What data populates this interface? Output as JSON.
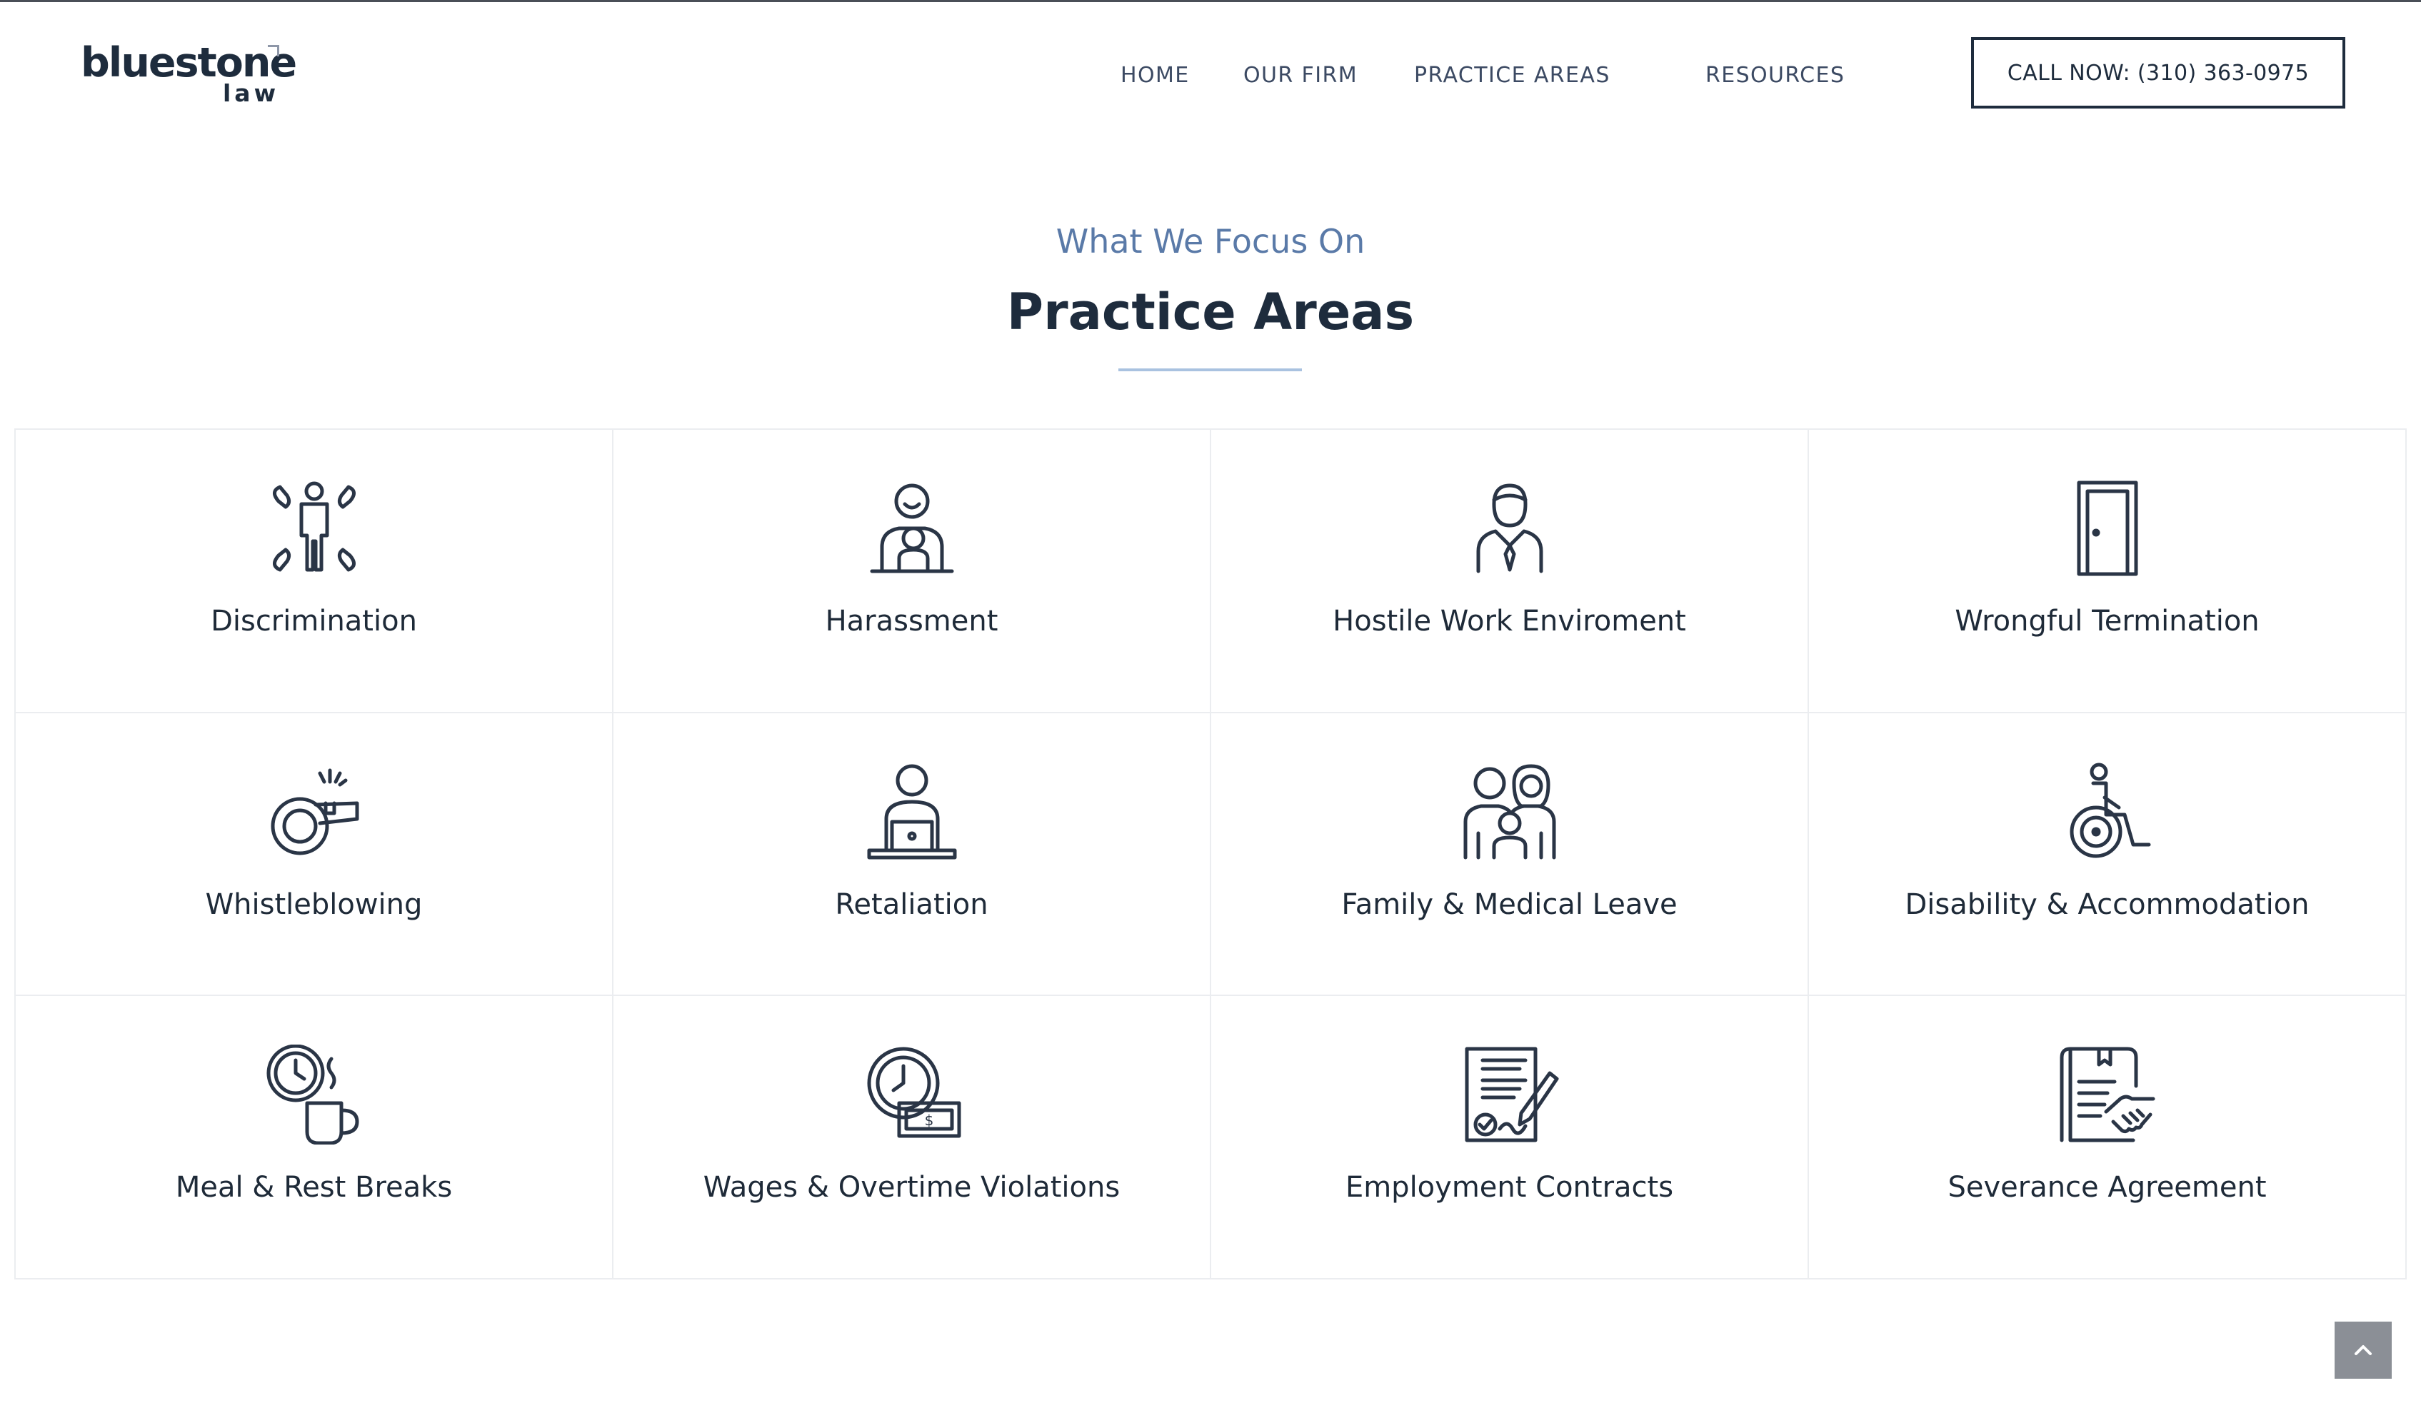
{
  "brand": {
    "name": "bluestone",
    "sub": "law"
  },
  "nav": {
    "items": [
      {
        "label": "HOME"
      },
      {
        "label": "OUR FIRM"
      },
      {
        "label": "PRACTICE AREAS"
      },
      {
        "label": "RESOURCES"
      }
    ],
    "cta_label": "CALL NOW: (310) 363-0975"
  },
  "section": {
    "eyebrow": "What We Focus On",
    "title": "Practice Areas"
  },
  "practice_areas": [
    {
      "label": "Discrimination",
      "icon": "discrimination-icon"
    },
    {
      "label": "Harassment",
      "icon": "harassment-icon"
    },
    {
      "label": "Hostile Work Enviroment",
      "icon": "businessman-icon"
    },
    {
      "label": "Wrongful Termination",
      "icon": "door-icon"
    },
    {
      "label": "Whistleblowing",
      "icon": "whistle-icon"
    },
    {
      "label": "Retaliation",
      "icon": "person-laptop-icon"
    },
    {
      "label": "Family & Medical Leave",
      "icon": "family-icon"
    },
    {
      "label": "Disability & Accommodation",
      "icon": "wheelchair-icon"
    },
    {
      "label": "Meal & Rest Breaks",
      "icon": "clock-coffee-icon"
    },
    {
      "label": "Wages & Overtime Violations",
      "icon": "clock-money-icon"
    },
    {
      "label": "Employment Contracts",
      "icon": "contract-icon"
    },
    {
      "label": "Severance Agreement",
      "icon": "handshake-document-icon"
    }
  ],
  "colors": {
    "navy": "#1e2c3d",
    "accent_blue": "#5a7aa8",
    "divider": "#a9c2e0",
    "grid_border": "#ebedf0",
    "back_to_top_bg": "#8b8f96"
  }
}
